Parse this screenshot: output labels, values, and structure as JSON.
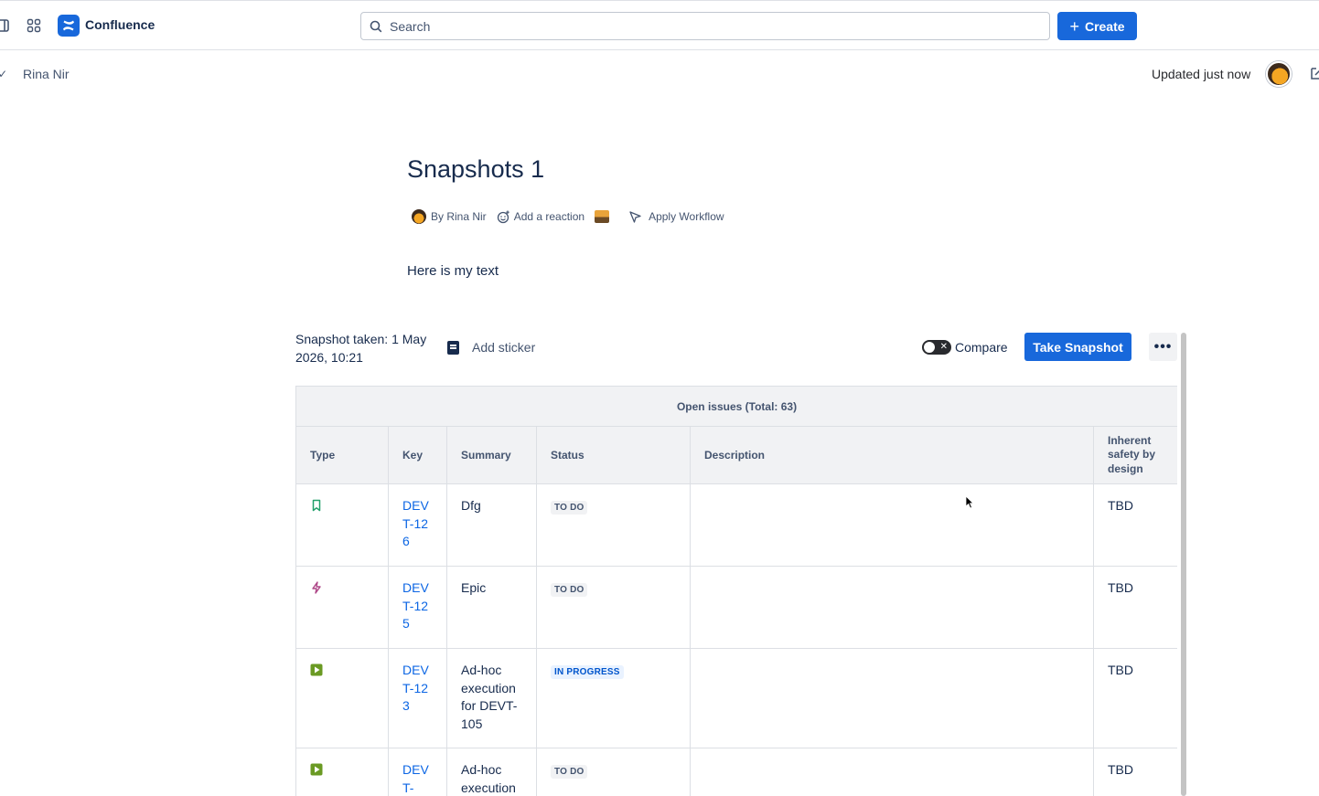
{
  "app": {
    "name": "Confluence",
    "brand_color": "#1868db"
  },
  "topbar": {
    "search_placeholder": "Search",
    "create_label": "Create"
  },
  "header": {
    "author": "Rina Nir",
    "status": "Updated just now"
  },
  "page": {
    "title": "Snapshots 1",
    "byline": "By Rina Nir",
    "add_reaction": "Add a reaction",
    "apply_workflow": "Apply Workflow",
    "body_text": "Here is my text"
  },
  "snapshot": {
    "taken": "Snapshot taken: 1 May 2026, 10:21",
    "add_sticker": "Add sticker",
    "compare": "Compare",
    "compare_on": false,
    "take_snapshot": "Take Snapshot"
  },
  "table": {
    "caption": "Open issues (Total: 63)",
    "headers": {
      "type": "Type",
      "key": "Key",
      "summary": "Summary",
      "status": "Status",
      "description": "Description",
      "safety": "Inherent safety by design"
    },
    "rows": [
      {
        "type_icon": "story-bookmark-icon",
        "key": "DEVT-126",
        "summary": "Dfg",
        "status": "TO DO",
        "description": "",
        "safety": "TBD"
      },
      {
        "type_icon": "epic-lightning-icon",
        "key": "DEVT-125",
        "summary": "Epic",
        "status": "TO DO",
        "description": "",
        "safety": "TBD"
      },
      {
        "type_icon": "test-execution-icon",
        "key": "DEVT-123",
        "summary": "Ad-hoc execution for DEVT-105",
        "status": "IN PROGRESS",
        "description": "",
        "safety": "TBD"
      },
      {
        "type_icon": "test-execution-icon",
        "key": "DEVT-",
        "summary": "Ad-hoc execution",
        "status": "TO DO",
        "description": "",
        "safety": "TBD"
      }
    ]
  },
  "colors": {
    "link": "#0c66e4",
    "story": "#22a06b",
    "epic": "#ae4787",
    "execution": "#6a9a23",
    "in_progress_bg": "#e9f2ff",
    "in_progress_fg": "#0055cc"
  }
}
